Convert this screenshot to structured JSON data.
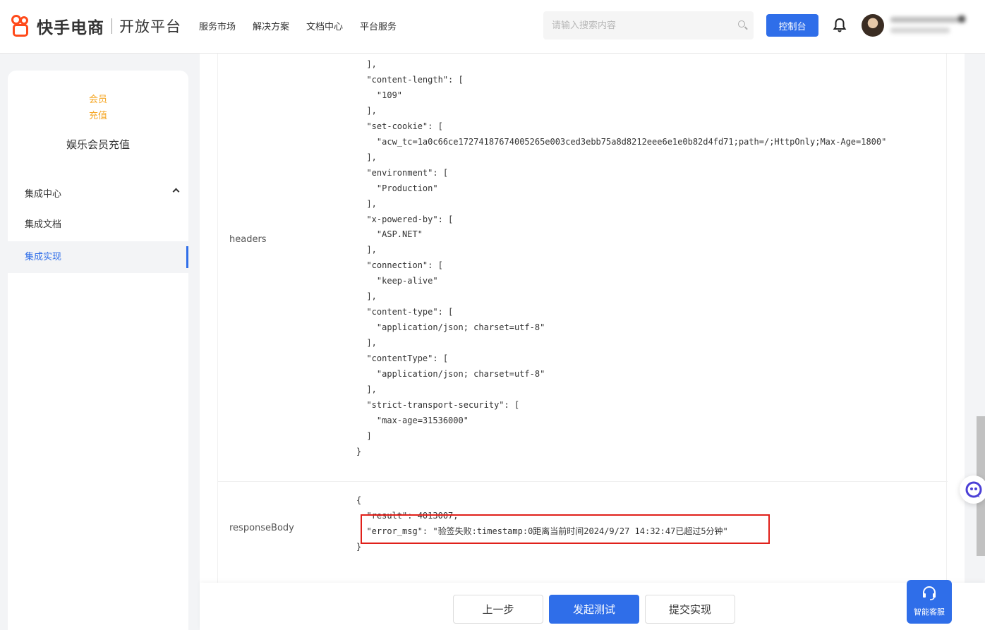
{
  "header": {
    "brand": "快手电商",
    "brand_sub": "开放平台",
    "nav": [
      "服务市场",
      "解决方案",
      "文档中心",
      "平台服务"
    ],
    "search_placeholder": "请输入搜索内容",
    "console_label": "控制台"
  },
  "sidebar": {
    "badge_line1": "会员",
    "badge_line2": "充值",
    "product_name": "娱乐会员充值",
    "group_label": "集成中心",
    "items": [
      {
        "label": "集成文档",
        "active": false
      },
      {
        "label": "集成实现",
        "active": true
      }
    ]
  },
  "main": {
    "headers_label": "headers",
    "headers_code": "  ],\n  \"content-length\": [\n    \"109\"\n  ],\n  \"set-cookie\": [\n    \"acw_tc=1a0c66ce17274187674005265e003ced3ebb75a8d8212eee6e1e0b82d4fd71;path=/;HttpOnly;Max-Age=1800\"\n  ],\n  \"environment\": [\n    \"Production\"\n  ],\n  \"x-powered-by\": [\n    \"ASP.NET\"\n  ],\n  \"connection\": [\n    \"keep-alive\"\n  ],\n  \"content-type\": [\n    \"application/json; charset=utf-8\"\n  ],\n  \"contentType\": [\n    \"application/json; charset=utf-8\"\n  ],\n  \"strict-transport-security\": [\n    \"max-age=31536000\"\n  ]\n}",
    "response_label": "responseBody",
    "response_code": "{\n  \"result\": 4013007,\n  \"error_msg\": \"验签失败:timestamp:0距离当前时间2024/9/27 14:32:47已超过5分钟\"\n}"
  },
  "footer": {
    "prev_label": "上一步",
    "test_label": "发起测试",
    "submit_label": "提交实现"
  },
  "service_label": "智能客服",
  "colors": {
    "primary": "#2f6ee9",
    "brand_orange": "#ff4a1a",
    "badge_orange": "#f5a623",
    "error_red": "#e0201a"
  },
  "icons": [
    "kuaishou-logo-icon",
    "search-icon",
    "bell-icon",
    "chevron-up-icon",
    "chat-bot-icon",
    "headset-icon"
  ]
}
